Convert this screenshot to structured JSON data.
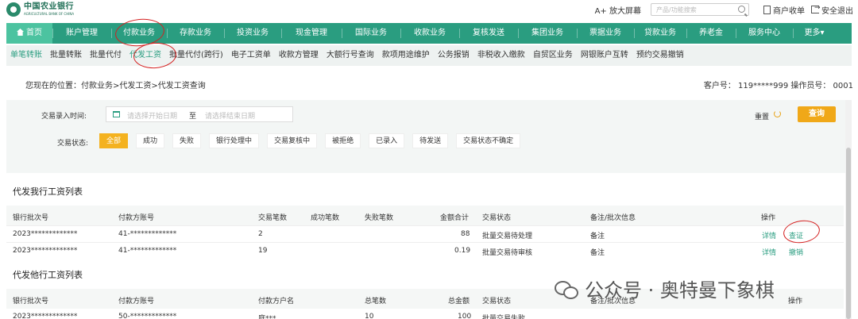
{
  "header": {
    "bank_name": "中国农业银行",
    "bank_name_en": "AGRICULTURAL BANK OF CHINA",
    "zoom_label": "A+ 放大屏幕",
    "search_placeholder": "产品/功能搜索",
    "receipt_link": "商户收单",
    "logout_link": "安全退出"
  },
  "main_nav": [
    {
      "label": "首页"
    },
    {
      "label": "账户管理"
    },
    {
      "label": "付款业务"
    },
    {
      "label": "存款业务"
    },
    {
      "label": "投资业务"
    },
    {
      "label": "现金管理"
    },
    {
      "label": "国际业务"
    },
    {
      "label": "收款业务"
    },
    {
      "label": "复核发送"
    },
    {
      "label": "集团业务"
    },
    {
      "label": "票据业务"
    },
    {
      "label": "贷款业务"
    },
    {
      "label": "养老金"
    },
    {
      "label": "服务中心"
    },
    {
      "label": "更多▾"
    }
  ],
  "sub_nav": [
    {
      "label": "单笔转账"
    },
    {
      "label": "批量转账"
    },
    {
      "label": "批量代付"
    },
    {
      "label": "代发工资"
    },
    {
      "label": "批量代付(跨行)"
    },
    {
      "label": "电子工资单"
    },
    {
      "label": "收款方管理"
    },
    {
      "label": "大额行号查询"
    },
    {
      "label": "款项用途维护"
    },
    {
      "label": "公务报销"
    },
    {
      "label": "非税收入缴款"
    },
    {
      "label": "自贸区业务"
    },
    {
      "label": "网银账户互转"
    },
    {
      "label": "预约交易撤销"
    }
  ],
  "breadcrumb": "您现在的位置：付款业务>代发工资>代发工资查询",
  "customer_info": "客户号： 119*****999    操作员号： 0001",
  "filter": {
    "time_label": "交易录入时间:",
    "start_placeholder": "请选择开始日期",
    "to_label": "至",
    "end_placeholder": "请选择结束日期",
    "status_label": "交易状态:",
    "statuses": [
      "全部",
      "成功",
      "失败",
      "银行处理中",
      "交易复核中",
      "被拒绝",
      "已录入",
      "待发送",
      "交易状态不确定"
    ],
    "reset_label": "重置",
    "query_label": "查询"
  },
  "own_bank_table": {
    "title": "代发我行工资列表",
    "headers": [
      "银行批次号",
      "付款方账号",
      "交易笔数",
      "成功笔数",
      "失败笔数",
      "金额合计",
      "交易状态",
      "备注/批次信息",
      "操作"
    ],
    "rows": [
      {
        "batch": "2023*************",
        "account": "41-*************",
        "count": "2",
        "success": "",
        "fail": "",
        "amount": "88",
        "status": "批量交易待处理",
        "remark": "备注",
        "op1": "详情",
        "op2": "查证"
      },
      {
        "batch": "2023*************",
        "account": "41-*************",
        "count": "19",
        "success": "",
        "fail": "",
        "amount": "0.19",
        "status": "批量交易待审核",
        "remark": "备注",
        "op1": "详情",
        "op2": "撤销"
      }
    ]
  },
  "other_bank_table": {
    "title": "代发他行工资列表",
    "headers": [
      "银行批次号",
      "付款方账号",
      "付款方户名",
      "总笔数",
      "总金额",
      "交易状态",
      "备注/批次信息",
      "操作"
    ],
    "rows": [
      {
        "batch": "2023*************",
        "account": "50-*************",
        "name": "庭***",
        "count": "10",
        "amount": "100",
        "status": "批量交易失败"
      }
    ]
  },
  "watermark": "公众号 · 奥特曼下象棋",
  "colors": {
    "primary": "#2a9d80",
    "accent": "#f0a818",
    "annotation": "#d42020"
  }
}
